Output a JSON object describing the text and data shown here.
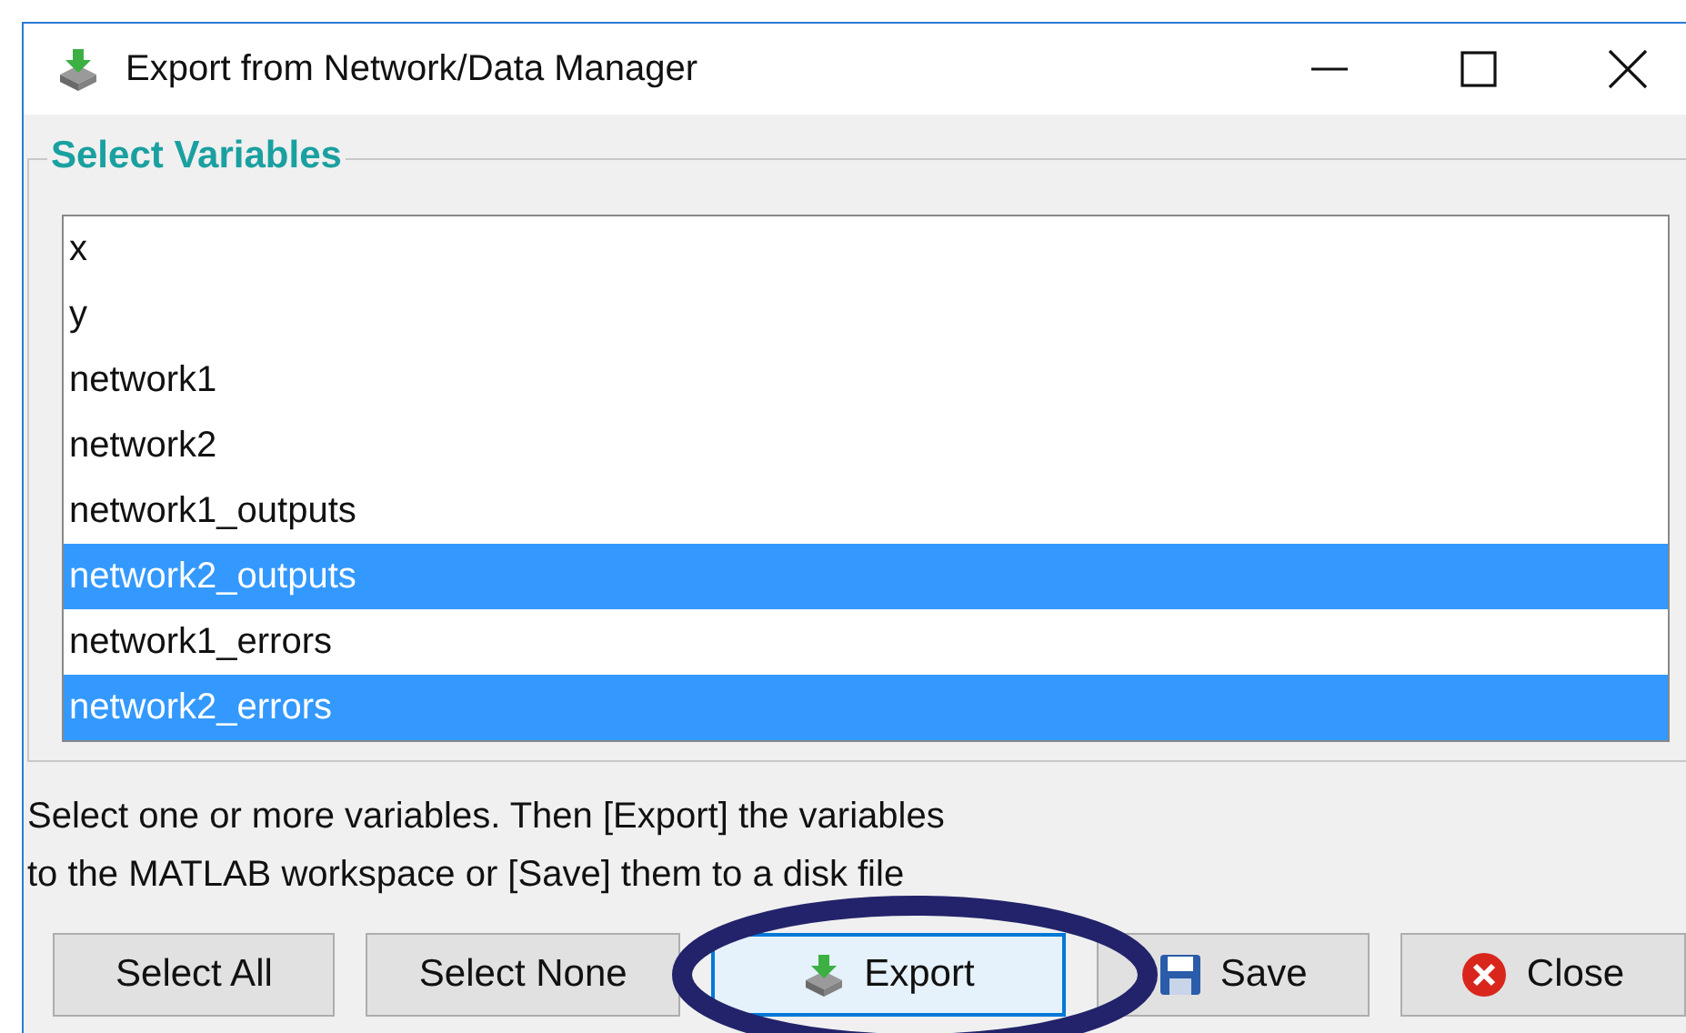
{
  "window": {
    "title": "Export from Network/Data Manager"
  },
  "group": {
    "label": "Select Variables"
  },
  "variables": [
    {
      "name": "x",
      "selected": false
    },
    {
      "name": "y",
      "selected": false
    },
    {
      "name": "network1",
      "selected": false
    },
    {
      "name": "network2",
      "selected": false
    },
    {
      "name": "network1_outputs",
      "selected": false
    },
    {
      "name": "network2_outputs",
      "selected": true
    },
    {
      "name": "network1_errors",
      "selected": false
    },
    {
      "name": "network2_errors",
      "selected": true
    }
  ],
  "help_lines": [
    "Select one or more variables. Then [Export] the variables",
    "to the MATLAB workspace or [Save] them to a disk file"
  ],
  "buttons": [
    {
      "label": "Select All",
      "kind": "plain",
      "focused": false
    },
    {
      "label": "Select None",
      "kind": "plain",
      "focused": false
    },
    {
      "label": "Export",
      "kind": "export",
      "focused": true
    },
    {
      "label": "Save",
      "kind": "save",
      "focused": false
    },
    {
      "label": "Close",
      "kind": "close",
      "focused": false
    }
  ],
  "annotation": {
    "kind": "ellipse"
  }
}
